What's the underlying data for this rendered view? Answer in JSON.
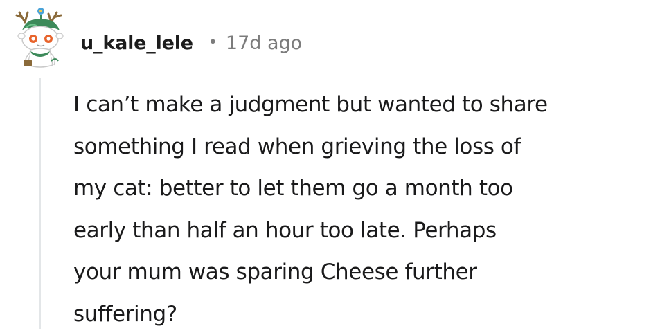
{
  "comment": {
    "author": {
      "username": "u_kale_lele",
      "avatar_icon": "snoo-avatar-icon"
    },
    "separator": "•",
    "timestamp": "17d ago",
    "body_lines": [
      "I can’t make a judgment but wanted to share",
      "something I read when grieving the loss of",
      "my cat: better to let them go a month too",
      "early than half an hour too late. Perhaps",
      "your mum was sparing Cheese further",
      "suffering?"
    ]
  },
  "colors": {
    "text": "#1a1a1b",
    "meta": "#7c7c7c",
    "thread_line": "#e3e6e8",
    "avatar_green": "#3d8a5a",
    "avatar_orange": "#e8642c"
  }
}
